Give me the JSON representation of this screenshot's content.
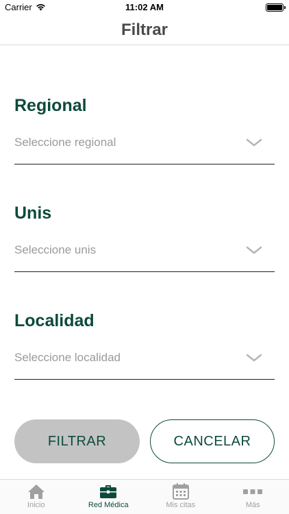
{
  "status_bar": {
    "carrier": "Carrier",
    "time": "11:02 AM",
    "icons": [
      "wifi-icon",
      "battery-icon"
    ]
  },
  "nav": {
    "title": "Filtrar"
  },
  "fields": [
    {
      "label": "Regional",
      "placeholder": "Seleccione regional"
    },
    {
      "label": "Unis",
      "placeholder": "Seleccione unis"
    },
    {
      "label": "Localidad",
      "placeholder": "Seleccione localidad"
    }
  ],
  "buttons": {
    "filter": "FILTRAR",
    "cancel": "CANCELAR"
  },
  "tabs": [
    {
      "label": "Inicio",
      "icon": "home-icon",
      "active": false
    },
    {
      "label": "Red Médica",
      "icon": "briefcase-icon",
      "active": true
    },
    {
      "label": "Mis citas",
      "icon": "calendar-icon",
      "active": false
    },
    {
      "label": "Más",
      "icon": "more-icon",
      "active": false
    }
  ],
  "colors": {
    "accent": "#0d4a3b",
    "inactive": "#a0a0a0",
    "placeholder": "#9a9a9a",
    "button_fill": "#c3c3c3"
  }
}
